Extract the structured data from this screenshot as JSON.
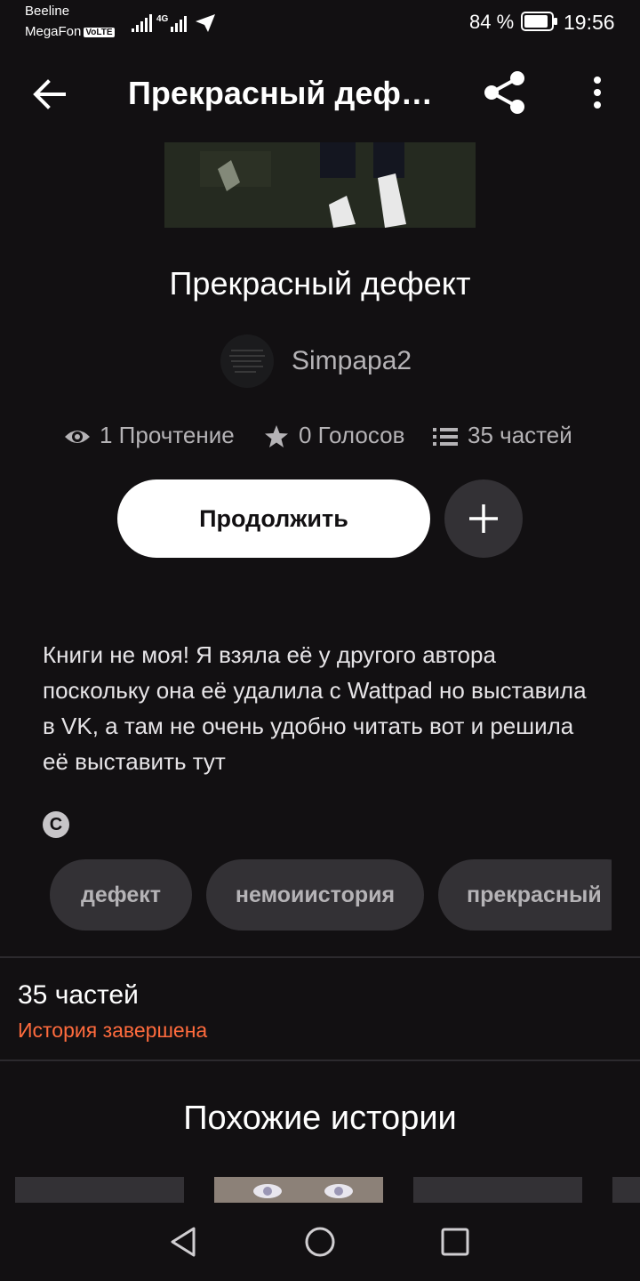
{
  "status_bar": {
    "carrier_1": "Beeline",
    "carrier_2": "MegaFon",
    "volte": "VoLTE",
    "network": "4G",
    "battery": "84 %",
    "time": "19:56"
  },
  "app_bar": {
    "title": "Прекрасный деф…",
    "icons": [
      "back-arrow-icon",
      "share-icon",
      "more-vert-icon"
    ]
  },
  "story": {
    "title": "Прекрасный дефект",
    "author": "Simpapa2",
    "stats": {
      "reads": "1 Прочтение",
      "votes": "0 Голосов",
      "parts": "35 частей"
    },
    "continue_label": "Продолжить",
    "description": "Книги не моя! Я взяла её у другого автора поскольку она её удалила с Wattpad но выставила в VK, а там не очень удобно читать вот и решила её выставить тут",
    "copyright_symbol": "C",
    "tags": [
      "дефект",
      "немоиистория",
      "прекрасный"
    ]
  },
  "parts_section": {
    "count": "35 частей",
    "status": "История завершена"
  },
  "similar": {
    "title": "Похожие истории"
  },
  "colors": {
    "background": "#121012",
    "accent": "#ff6b3d",
    "chip": "#333135"
  }
}
